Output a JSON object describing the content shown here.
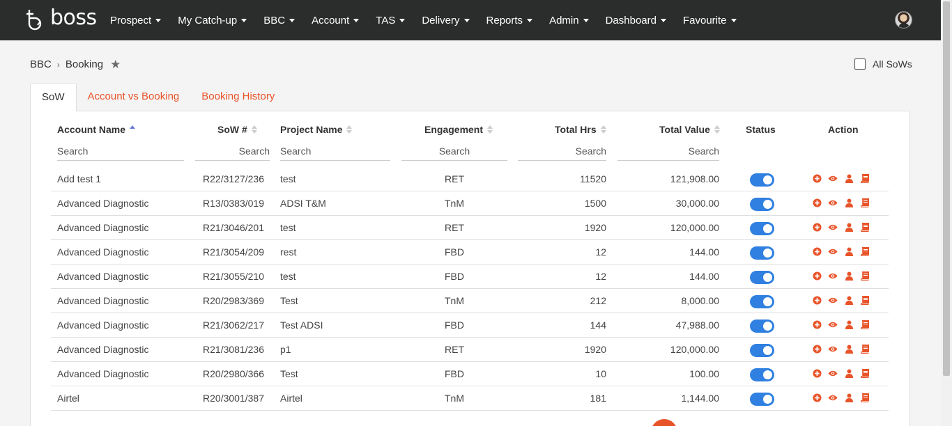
{
  "brand": {
    "logo_text": "boss"
  },
  "nav": {
    "items": [
      "Prospect",
      "My Catch-up",
      "BBC",
      "Account",
      "TAS",
      "Delivery",
      "Reports",
      "Admin",
      "Dashboard",
      "Favourite"
    ]
  },
  "breadcrumb": {
    "root": "BBC",
    "current": "Booking"
  },
  "all_sows": {
    "label": "All SoWs",
    "checked": false
  },
  "tabs": [
    {
      "label": "SoW",
      "active": true
    },
    {
      "label": "Account vs Booking",
      "active": false
    },
    {
      "label": "Booking History",
      "active": false
    }
  ],
  "table": {
    "headers": {
      "account": "Account Name",
      "sow": "SoW #",
      "project": "Project Name",
      "engagement": "Engagement",
      "hrs": "Total Hrs",
      "value": "Total Value",
      "status": "Status",
      "action": "Action"
    },
    "search_placeholder": "Search",
    "rows": [
      {
        "account": "Add test 1",
        "sow": "R22/3127/236",
        "project": "test",
        "engagement": "RET",
        "hrs": "11520",
        "value": "121,908.00",
        "status": true
      },
      {
        "account": "Advanced Diagnostic",
        "sow": "R13/0383/019",
        "project": "ADSI T&M",
        "engagement": "TnM",
        "hrs": "1500",
        "value": "30,000.00",
        "status": true
      },
      {
        "account": "Advanced Diagnostic",
        "sow": "R21/3046/201",
        "project": "test",
        "engagement": "RET",
        "hrs": "1920",
        "value": "120,000.00",
        "status": true
      },
      {
        "account": "Advanced Diagnostic",
        "sow": "R21/3054/209",
        "project": "rest",
        "engagement": "FBD",
        "hrs": "12",
        "value": "144.00",
        "status": true
      },
      {
        "account": "Advanced Diagnostic",
        "sow": "R21/3055/210",
        "project": "test",
        "engagement": "FBD",
        "hrs": "12",
        "value": "144.00",
        "status": true
      },
      {
        "account": "Advanced Diagnostic",
        "sow": "R20/2983/369",
        "project": "Test",
        "engagement": "TnM",
        "hrs": "212",
        "value": "8,000.00",
        "status": true
      },
      {
        "account": "Advanced Diagnostic",
        "sow": "R21/3062/217",
        "project": "Test ADSI",
        "engagement": "FBD",
        "hrs": "144",
        "value": "47,988.00",
        "status": true
      },
      {
        "account": "Advanced Diagnostic",
        "sow": "R21/3081/236",
        "project": "p1",
        "engagement": "RET",
        "hrs": "1920",
        "value": "120,000.00",
        "status": true
      },
      {
        "account": "Advanced Diagnostic",
        "sow": "R20/2980/366",
        "project": "Test",
        "engagement": "FBD",
        "hrs": "10",
        "value": "100.00",
        "status": true
      },
      {
        "account": "Airtel",
        "sow": "R20/3001/387",
        "project": "Airtel",
        "engagement": "TnM",
        "hrs": "181",
        "value": "1,144.00",
        "status": true
      }
    ],
    "action_icons": [
      "plus-circle-icon",
      "eye-icon",
      "user-icon",
      "book-icon"
    ]
  },
  "colors": {
    "accent": "#e8542a",
    "toggle_on": "#2f80e0",
    "nav_bg": "#2b2d2d"
  }
}
